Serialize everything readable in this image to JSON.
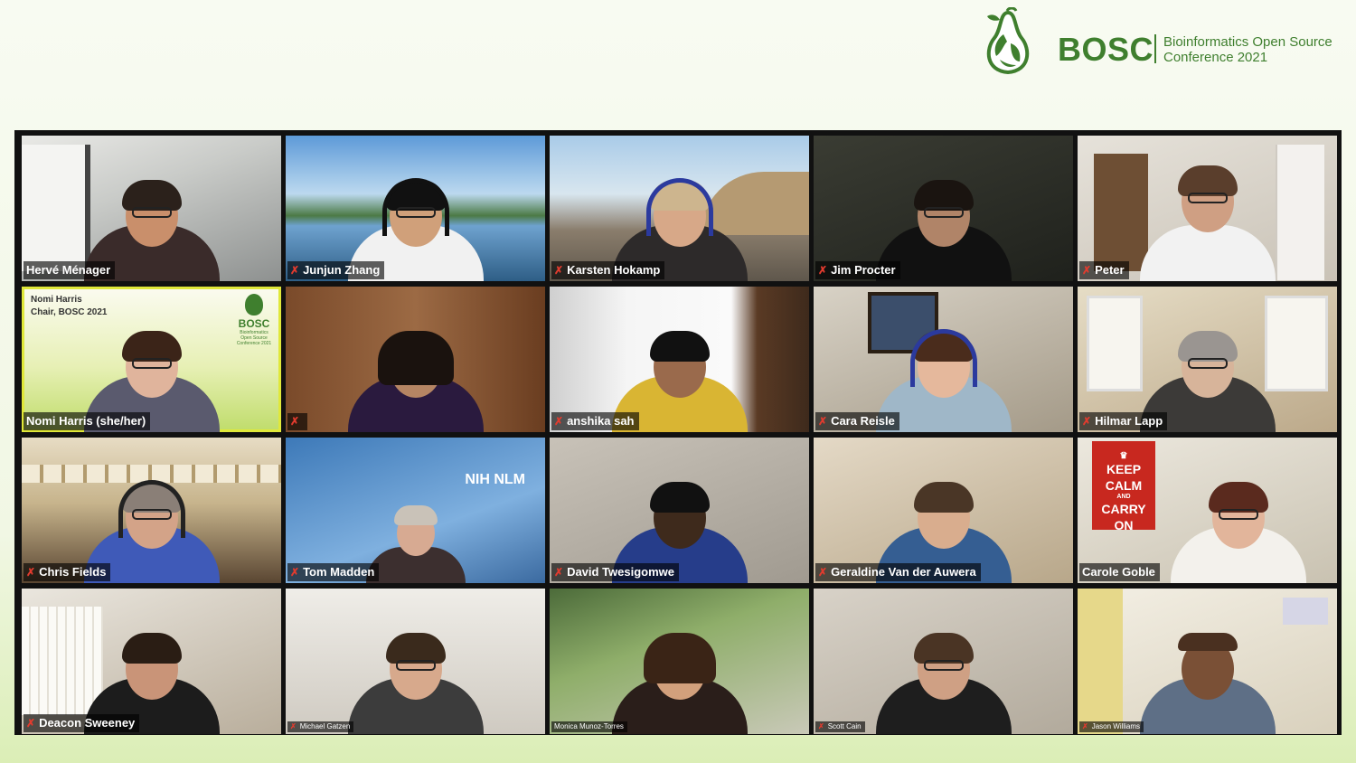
{
  "conference": {
    "brand": "BOSC",
    "subtitle_line1": "Bioinformatics Open Source",
    "subtitle_line2": "Conference 2021",
    "brand_color": "#3f7f2e"
  },
  "chair_card": {
    "name": "Nomi Harris",
    "role": "Chair, BOSC 2021",
    "mini_brand": "BOSC",
    "mini_sub": "Bioinformatics Open Source Conference 2021"
  },
  "keep_calm": [
    "KEEP",
    "CALM",
    "AND",
    "CARRY",
    "ON"
  ],
  "nih_logo": "NIH NLM",
  "participants": [
    {
      "name": "Hervé Ménager",
      "muted": false
    },
    {
      "name": "Junjun Zhang",
      "muted": true
    },
    {
      "name": "Karsten Hokamp",
      "muted": true
    },
    {
      "name": "Jim Procter",
      "muted": true
    },
    {
      "name": "Peter",
      "muted": true
    },
    {
      "name": "Nomi Harris  (she/her)",
      "muted": false,
      "active_speaker": true
    },
    {
      "name": "",
      "muted": true
    },
    {
      "name": "anshika sah",
      "muted": true
    },
    {
      "name": "Cara Reisle",
      "muted": true
    },
    {
      "name": "Hilmar Lapp",
      "muted": true
    },
    {
      "name": "Chris Fields",
      "muted": true
    },
    {
      "name": "Tom Madden",
      "muted": true
    },
    {
      "name": "David Twesigomwe",
      "muted": true
    },
    {
      "name": "Geraldine Van der Auwera",
      "muted": true
    },
    {
      "name": "Carole Goble",
      "muted": false
    },
    {
      "name": "Deacon Sweeney",
      "muted": true
    },
    {
      "name": "Michael Gatzen",
      "muted": true,
      "small_label": true
    },
    {
      "name": "Monica Munoz-Torres",
      "muted": false,
      "small_label": true
    },
    {
      "name": "Scott Cain",
      "muted": true,
      "small_label": true
    },
    {
      "name": "Jason Williams",
      "muted": true,
      "small_label": true
    }
  ],
  "icons": {
    "mute": "muted-mic-icon"
  },
  "colors": {
    "mute_red": "#e23b2e",
    "active_border": "#e0e83a"
  }
}
